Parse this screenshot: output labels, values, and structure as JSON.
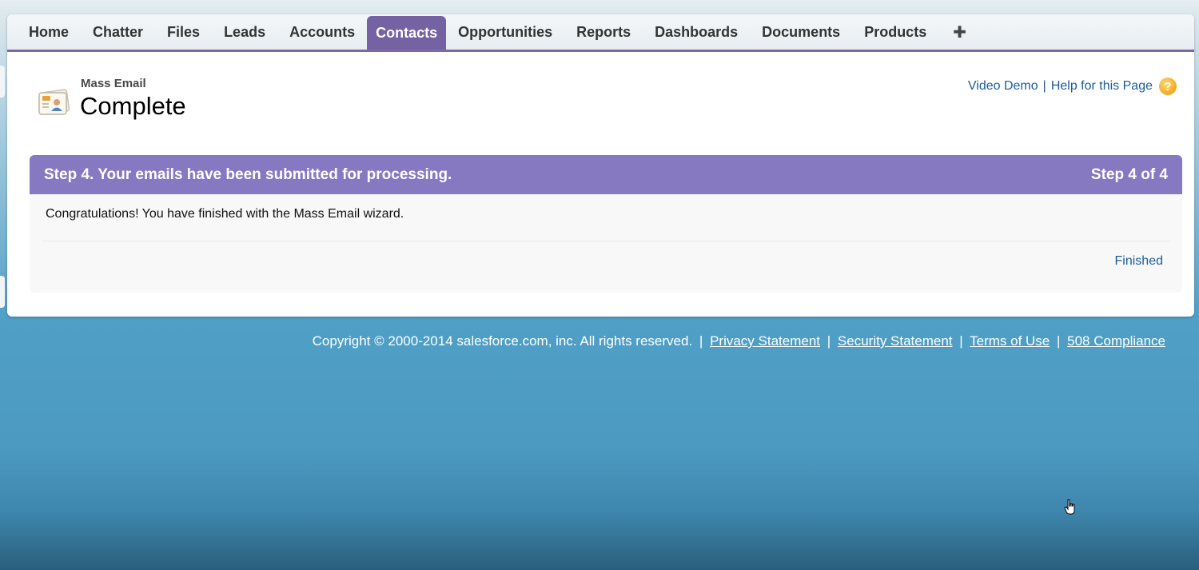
{
  "nav": {
    "tabs": [
      "Home",
      "Chatter",
      "Files",
      "Leads",
      "Accounts",
      "Contacts",
      "Opportunities",
      "Reports",
      "Dashboards",
      "Documents",
      "Products"
    ],
    "active_tab": "Contacts",
    "plus_label": "✚",
    "active_color": "#7562a3"
  },
  "header": {
    "page_type": "Mass Email",
    "page_title": "Complete",
    "icon": "contact-card-icon",
    "video_demo": "Video Demo",
    "separator": "|",
    "help_link": "Help for this Page",
    "help_icon_glyph": "?"
  },
  "step": {
    "title": "Step 4. Your emails have been submitted for processing.",
    "counter": "Step 4 of 4",
    "message": "Congratulations! You have finished with the Mass Email wizard.",
    "finished_link": "Finished",
    "header_color": "#8778c2"
  },
  "footer": {
    "copyright": "Copyright © 2000-2014 salesforce.com, inc. All rights reserved.",
    "separator": "|",
    "links": [
      "Privacy Statement",
      "Security Statement",
      "Terms of Use",
      "508 Compliance"
    ]
  }
}
